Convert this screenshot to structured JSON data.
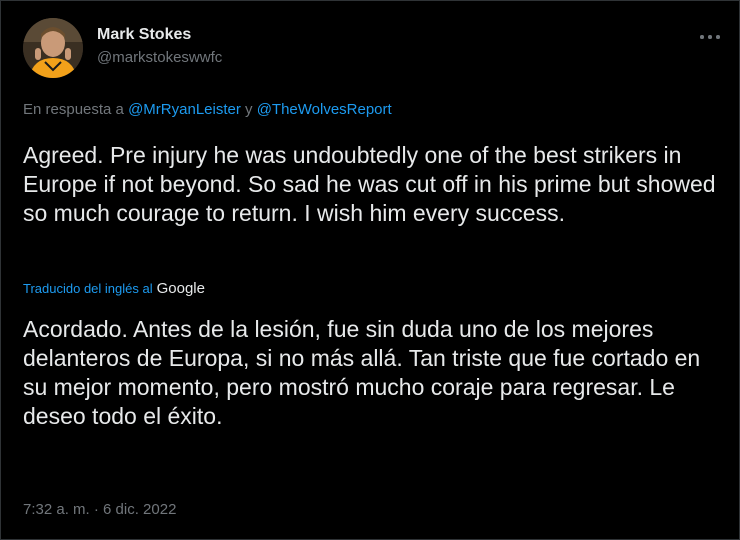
{
  "user": {
    "display_name": "Mark Stokes",
    "handle": "@markstokeswwfc",
    "avatar_icon": "user-avatar-photo"
  },
  "more_icon": "more-horizontal-icon",
  "reply": {
    "prefix": "En respuesta a ",
    "mention1": "@MrRyanLeister",
    "connector": " y ",
    "mention2": "@TheWolvesReport"
  },
  "tweet": {
    "text": "Agreed. Pre injury he was undoubtedly one of the best strikers in Europe if not beyond. So sad he was cut off in his prime but showed so much courage to return. I wish him every success."
  },
  "translation": {
    "label": "Traducido del inglés al",
    "provider": "Google",
    "text": "Acordado. Antes de la lesión, fue sin duda uno de los mejores delanteros de Europa, si no más allá. Tan triste que fue cortado en su mejor momento, pero mostró mucho coraje para regresar. Le deseo todo el éxito."
  },
  "timestamp": "7:32 a. m. · 6 dic. 2022",
  "colors": {
    "background": "#000000",
    "text": "#e7e9ea",
    "secondary": "#71767b",
    "accent": "#1d9bf0",
    "border": "#2f3336"
  }
}
